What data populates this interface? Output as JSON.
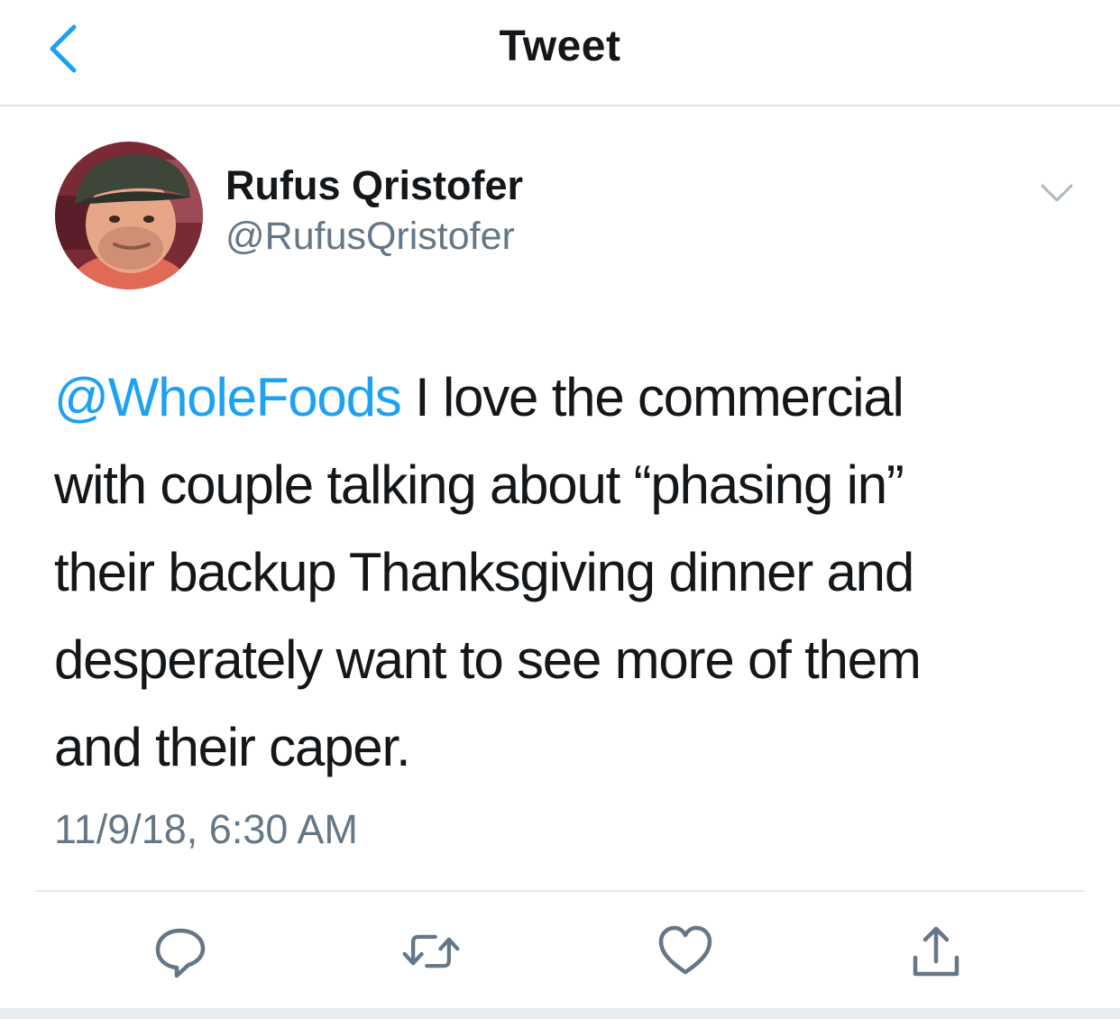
{
  "header": {
    "title": "Tweet",
    "back_icon": "chevron-left-icon"
  },
  "author": {
    "name": "Rufus Qristofer",
    "handle": "@RufusQristofer",
    "avatar": "avatar-photo",
    "menu_icon": "chevron-down-icon"
  },
  "tweet": {
    "lines": [
      {
        "mention": "@WholeFoods",
        "text": " I love the commercial"
      },
      {
        "text": "with couple talking about “phasing in”"
      },
      {
        "text": "their backup Thanksgiving dinner and"
      },
      {
        "text": "desperately want to see more of them"
      },
      {
        "text": "and their caper."
      }
    ],
    "timestamp": "11/9/18, 6:30 AM"
  },
  "actions": [
    {
      "name": "reply",
      "icon": "reply-icon"
    },
    {
      "name": "retweet",
      "icon": "retweet-icon"
    },
    {
      "name": "like",
      "icon": "heart-icon"
    },
    {
      "name": "share",
      "icon": "share-icon"
    }
  ],
  "colors": {
    "accent": "#1da1f2",
    "text": "#14171a",
    "secondary": "#657786",
    "icon": "#657786",
    "divider": "#e1e8ed"
  }
}
